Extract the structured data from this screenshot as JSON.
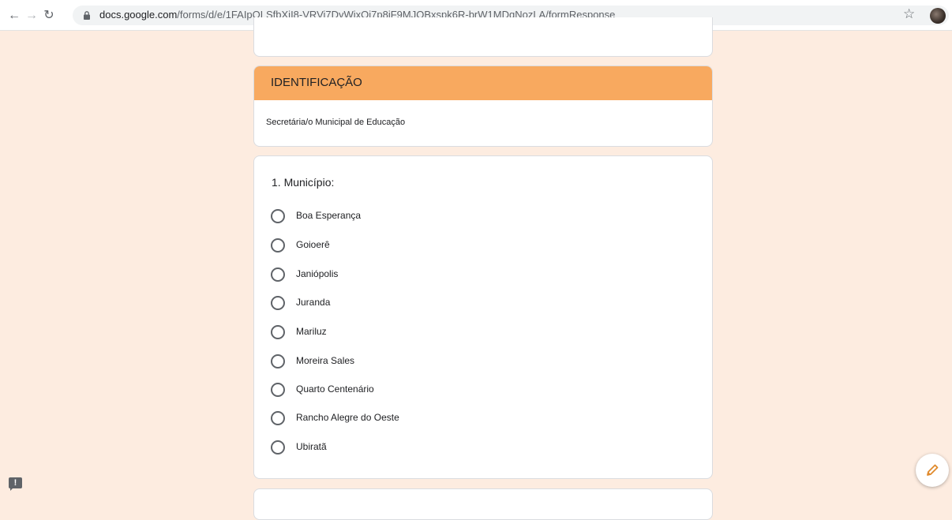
{
  "browser": {
    "url_domain": "docs.google.com",
    "url_path": "/forms/d/e/1FAIpQLSfbXjI8-VRVi7DyWixOj7p8jF9MJOBxspk6R-brW1MDqNozLA/formResponse",
    "icons": {
      "back": "arrow-left-icon",
      "forward": "arrow-right-icon",
      "reload": "reload-icon",
      "lock": "lock-icon",
      "bookmark": "star-icon"
    }
  },
  "section": {
    "header": "IDENTIFICAÇÃO",
    "description": "Secretária/o Municipal de Educação",
    "header_color": "#f8a95f"
  },
  "question": {
    "title": "1. Município:",
    "options": [
      "Boa Esperança",
      "Goioerê",
      "Janiópolis",
      "Juranda",
      "Mariluz",
      "Moreira Sales",
      "Quarto Centenário",
      "Rancho Alegre do Oeste",
      "Ubiratã"
    ]
  },
  "theme": {
    "background": "#fdece0",
    "accent": "#f8a95f"
  }
}
